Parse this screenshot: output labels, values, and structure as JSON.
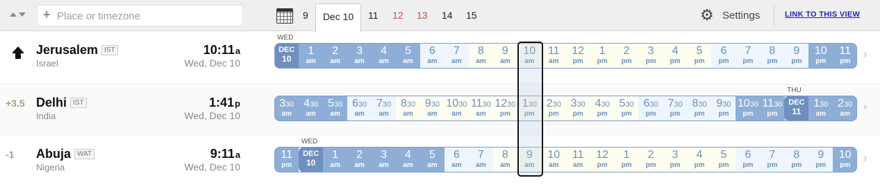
{
  "toolbar": {
    "search_placeholder": "Place or timezone",
    "tabs": [
      {
        "label": "9",
        "weekend": false
      },
      {
        "label": "Dec 10",
        "weekend": false,
        "active": true
      },
      {
        "label": "11",
        "weekend": false
      },
      {
        "label": "12",
        "weekend": true
      },
      {
        "label": "13",
        "weekend": true
      },
      {
        "label": "14",
        "weekend": false
      },
      {
        "label": "15",
        "weekend": false
      }
    ],
    "settings_label": "Settings",
    "link_label": "LINK TO THIS VIEW"
  },
  "rows": [
    {
      "offset": "",
      "home": true,
      "city": "Jerusalem",
      "abbr": "IST",
      "country": "Israel",
      "time": "10:11",
      "ampm": "a",
      "date": "Wed, Dec 10",
      "day_labels": [
        {
          "text": "WED",
          "cell": 0
        }
      ],
      "cells": [
        {
          "t": "DEC",
          "b": "10",
          "k": "date"
        },
        {
          "t": "1",
          "b": "am",
          "k": "dark"
        },
        {
          "t": "2",
          "b": "am",
          "k": "dark"
        },
        {
          "t": "3",
          "b": "am",
          "k": "dark"
        },
        {
          "t": "4",
          "b": "am",
          "k": "dark"
        },
        {
          "t": "5",
          "b": "am",
          "k": "dark"
        },
        {
          "t": "6",
          "b": "am",
          "k": "light"
        },
        {
          "t": "7",
          "b": "am",
          "k": "light"
        },
        {
          "t": "8",
          "b": "am",
          "k": "day"
        },
        {
          "t": "9",
          "b": "am",
          "k": "day"
        },
        {
          "t": "10",
          "b": "am",
          "k": "day"
        },
        {
          "t": "11",
          "b": "am",
          "k": "day"
        },
        {
          "t": "12",
          "b": "pm",
          "k": "day"
        },
        {
          "t": "1",
          "b": "pm",
          "k": "day"
        },
        {
          "t": "2",
          "b": "pm",
          "k": "day"
        },
        {
          "t": "3",
          "b": "pm",
          "k": "day"
        },
        {
          "t": "4",
          "b": "pm",
          "k": "day"
        },
        {
          "t": "5",
          "b": "pm",
          "k": "day"
        },
        {
          "t": "6",
          "b": "pm",
          "k": "light"
        },
        {
          "t": "7",
          "b": "pm",
          "k": "light"
        },
        {
          "t": "8",
          "b": "pm",
          "k": "light"
        },
        {
          "t": "9",
          "b": "pm",
          "k": "light"
        },
        {
          "t": "10",
          "b": "pm",
          "k": "dark"
        },
        {
          "t": "11",
          "b": "pm",
          "k": "dark"
        }
      ]
    },
    {
      "offset": "+3.5",
      "home": false,
      "city": "Delhi",
      "abbr": "IST",
      "country": "India",
      "time": "1:41",
      "ampm": "p",
      "date": "Wed, Dec 10",
      "day_labels": [
        {
          "text": "THU",
          "cell": 21
        }
      ],
      "cells": [
        {
          "t": "3",
          "h": "30",
          "b": "am",
          "k": "dark"
        },
        {
          "t": "4",
          "h": "30",
          "b": "am",
          "k": "dark"
        },
        {
          "t": "5",
          "h": "30",
          "b": "am",
          "k": "dark"
        },
        {
          "t": "6",
          "h": "30",
          "b": "am",
          "k": "light"
        },
        {
          "t": "7",
          "h": "30",
          "b": "am",
          "k": "light"
        },
        {
          "t": "8",
          "h": "30",
          "b": "am",
          "k": "day"
        },
        {
          "t": "9",
          "h": "30",
          "b": "am",
          "k": "day"
        },
        {
          "t": "10",
          "h": "30",
          "b": "am",
          "k": "day"
        },
        {
          "t": "11",
          "h": "30",
          "b": "am",
          "k": "day"
        },
        {
          "t": "12",
          "h": "30",
          "b": "pm",
          "k": "day"
        },
        {
          "t": "1",
          "h": "30",
          "b": "pm",
          "k": "day"
        },
        {
          "t": "2",
          "h": "30",
          "b": "pm",
          "k": "day"
        },
        {
          "t": "3",
          "h": "30",
          "b": "pm",
          "k": "day"
        },
        {
          "t": "4",
          "h": "30",
          "b": "pm",
          "k": "day"
        },
        {
          "t": "5",
          "h": "30",
          "b": "pm",
          "k": "day"
        },
        {
          "t": "6",
          "h": "30",
          "b": "pm",
          "k": "light"
        },
        {
          "t": "7",
          "h": "30",
          "b": "pm",
          "k": "light"
        },
        {
          "t": "8",
          "h": "30",
          "b": "pm",
          "k": "light"
        },
        {
          "t": "9",
          "h": "30",
          "b": "pm",
          "k": "light"
        },
        {
          "t": "10",
          "h": "30",
          "b": "pm",
          "k": "dark"
        },
        {
          "t": "11",
          "h": "30",
          "b": "pm",
          "k": "dark"
        },
        {
          "t": "DEC",
          "b": "11",
          "k": "date"
        },
        {
          "t": "1",
          "h": "30",
          "b": "am",
          "k": "dark"
        },
        {
          "t": "2",
          "h": "30",
          "b": "am",
          "k": "dark"
        }
      ]
    },
    {
      "offset": "-1",
      "home": false,
      "city": "Abuja",
      "abbr": "WAT",
      "country": "Nigeria",
      "time": "9:11",
      "ampm": "a",
      "date": "Wed, Dec 10",
      "day_labels": [
        {
          "text": "WED",
          "cell": 1
        }
      ],
      "cells": [
        {
          "t": "11",
          "b": "pm",
          "k": "dark"
        },
        {
          "t": "DEC",
          "b": "10",
          "k": "date"
        },
        {
          "t": "1",
          "b": "am",
          "k": "dark"
        },
        {
          "t": "2",
          "b": "am",
          "k": "dark"
        },
        {
          "t": "3",
          "b": "am",
          "k": "dark"
        },
        {
          "t": "4",
          "b": "am",
          "k": "dark"
        },
        {
          "t": "5",
          "b": "am",
          "k": "dark"
        },
        {
          "t": "6",
          "b": "am",
          "k": "light"
        },
        {
          "t": "7",
          "b": "am",
          "k": "light"
        },
        {
          "t": "8",
          "b": "am",
          "k": "day"
        },
        {
          "t": "9",
          "b": "am",
          "k": "day"
        },
        {
          "t": "10",
          "b": "am",
          "k": "day"
        },
        {
          "t": "11",
          "b": "am",
          "k": "day"
        },
        {
          "t": "12",
          "b": "pm",
          "k": "day"
        },
        {
          "t": "1",
          "b": "pm",
          "k": "day"
        },
        {
          "t": "2",
          "b": "pm",
          "k": "day"
        },
        {
          "t": "3",
          "b": "pm",
          "k": "day"
        },
        {
          "t": "4",
          "b": "pm",
          "k": "day"
        },
        {
          "t": "5",
          "b": "pm",
          "k": "day"
        },
        {
          "t": "6",
          "b": "pm",
          "k": "light"
        },
        {
          "t": "7",
          "b": "pm",
          "k": "light"
        },
        {
          "t": "8",
          "b": "pm",
          "k": "light"
        },
        {
          "t": "9",
          "b": "pm",
          "k": "light"
        },
        {
          "t": "10",
          "b": "pm",
          "k": "dark"
        }
      ]
    }
  ],
  "colors": {
    "dark": "#8eaed6",
    "light": "#eef5fc",
    "day": "#fdfdf0",
    "date": "#6f8fbf",
    "weekend_tab": "#c0504d"
  }
}
